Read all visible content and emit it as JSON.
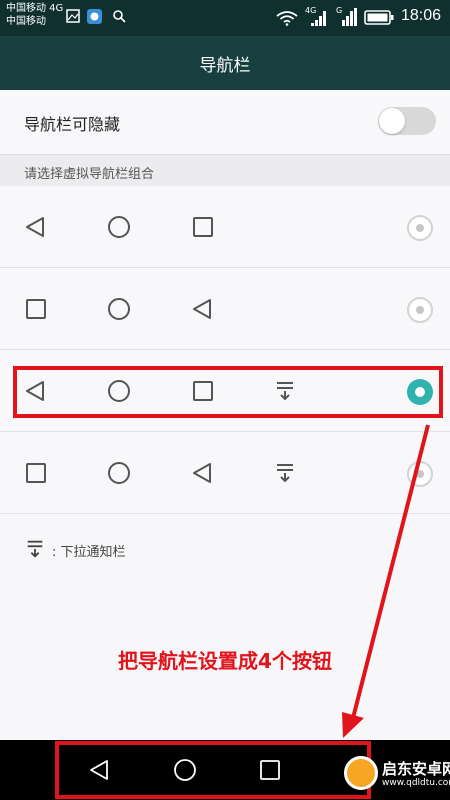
{
  "status_bar": {
    "carrier_1": "中国移动 4G",
    "carrier_2": "中国移动",
    "net_badge_1": "4G",
    "net_badge_2": "G",
    "time": "18:06"
  },
  "title_bar": {
    "title": "导航栏"
  },
  "settings": {
    "hide_label": "导航栏可隐藏",
    "hide_enabled": false,
    "section_header": "请选择虚拟导航栏组合",
    "options": [
      {
        "icons": [
          "back-icon",
          "home-icon",
          "recent-icon"
        ],
        "selected": false
      },
      {
        "icons": [
          "recent-icon",
          "home-icon",
          "back-icon"
        ],
        "selected": false
      },
      {
        "icons": [
          "back-icon",
          "home-icon",
          "recent-icon",
          "notification-icon"
        ],
        "selected": true
      },
      {
        "icons": [
          "recent-icon",
          "home-icon",
          "back-icon",
          "notification-icon"
        ],
        "selected": false
      }
    ],
    "legend_label": ": 下拉通知栏"
  },
  "annotation": "把导航栏设置成4个按钮",
  "colors": {
    "title_bar": "#173f3f",
    "status_bar": "#10302f",
    "accent": "#2fb3b0",
    "annotation": "#e0141a"
  },
  "watermark": {
    "name": "启东安卓网",
    "url": "www.qdldtu.com"
  }
}
